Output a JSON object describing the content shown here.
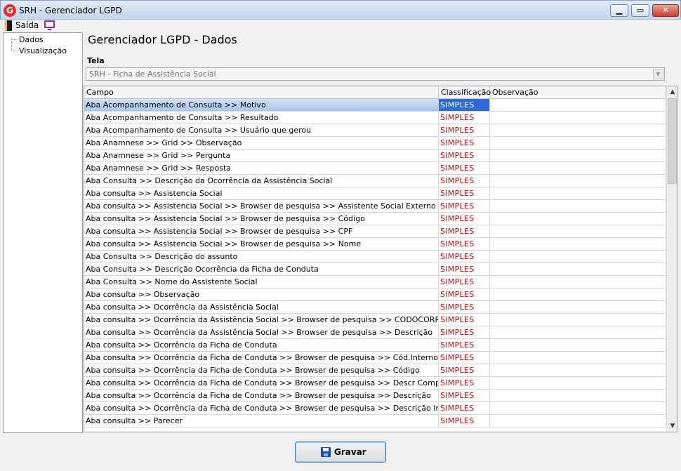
{
  "window": {
    "title": "SRH - Gerenciador LGPD",
    "app_icon_letter": "G",
    "minimize_glyph": "▁",
    "maximize_glyph": "▭",
    "close_glyph": "✕"
  },
  "menu": {
    "exit_label": "Saída"
  },
  "tree": {
    "items": [
      "Dados",
      "Visualização"
    ]
  },
  "page": {
    "title": "Gerenciador LGPD - Dados",
    "tela_label": "Tela",
    "tela_value": "SRH - Ficha de Assistência Social"
  },
  "grid": {
    "columns": [
      "Campo",
      "Classificação",
      "Observação"
    ],
    "rows": [
      {
        "campo": "Aba Acompanhamento de Consulta >> Motivo",
        "classificacao": "SIMPLES",
        "observacao": ""
      },
      {
        "campo": "Aba Acompanhamento de Consulta >> Resultado",
        "classificacao": "SIMPLES",
        "observacao": ""
      },
      {
        "campo": "Aba Acompanhamento de Consulta >> Usuário que gerou",
        "classificacao": "SIMPLES",
        "observacao": ""
      },
      {
        "campo": "Aba Anamnese >> Grid >> Observação",
        "classificacao": "SIMPLES",
        "observacao": ""
      },
      {
        "campo": "Aba Anamnese >> Grid >> Pergunta",
        "classificacao": "SIMPLES",
        "observacao": ""
      },
      {
        "campo": "Aba Anamnese >> Grid >> Resposta",
        "classificacao": "SIMPLES",
        "observacao": ""
      },
      {
        "campo": "Aba Consulta >>  Descrição da Ocorrência da Assistência Social",
        "classificacao": "SIMPLES",
        "observacao": ""
      },
      {
        "campo": "Aba consulta >> Assistencia Social",
        "classificacao": "SIMPLES",
        "observacao": ""
      },
      {
        "campo": "Aba consulta >> Assistencia Social >> Browser de pesquisa >> Assistente Social Externo",
        "classificacao": "SIMPLES",
        "observacao": ""
      },
      {
        "campo": "Aba consulta >> Assistencia Social >> Browser de pesquisa >> Código",
        "classificacao": "SIMPLES",
        "observacao": ""
      },
      {
        "campo": "Aba consulta >> Assistencia Social >> Browser de pesquisa >> CPF",
        "classificacao": "SIMPLES",
        "observacao": ""
      },
      {
        "campo": "Aba consulta >> Assistencia Social >> Browser de pesquisa >> Nome",
        "classificacao": "SIMPLES",
        "observacao": ""
      },
      {
        "campo": "Aba Consulta >> Descrição do assunto",
        "classificacao": "SIMPLES",
        "observacao": ""
      },
      {
        "campo": "Aba Consulta >> Descrição Ocorrência da Ficha de Conduta",
        "classificacao": "SIMPLES",
        "observacao": ""
      },
      {
        "campo": "Aba Consulta >> Nome do Assistente Social",
        "classificacao": "SIMPLES",
        "observacao": ""
      },
      {
        "campo": "Aba consulta >> Observação",
        "classificacao": "SIMPLES",
        "observacao": ""
      },
      {
        "campo": "Aba consulta >> Ocorrência da Assistência Social",
        "classificacao": "SIMPLES",
        "observacao": ""
      },
      {
        "campo": "Aba consulta >> Ocorrência da Assistência Social >> Browser de pesquisa >> CODOCORR",
        "classificacao": "SIMPLES",
        "observacao": ""
      },
      {
        "campo": "Aba consulta >> Ocorrência da Assistência Social >> Browser de pesquisa >> Descrição",
        "classificacao": "SIMPLES",
        "observacao": ""
      },
      {
        "campo": "Aba consulta >> Ocorrência da Ficha de Conduta",
        "classificacao": "SIMPLES",
        "observacao": ""
      },
      {
        "campo": "Aba consulta >> Ocorrência da Ficha de Conduta >> Browser de pesquisa >> Cód.Interno",
        "classificacao": "SIMPLES",
        "observacao": ""
      },
      {
        "campo": "Aba consulta >> Ocorrência da Ficha de Conduta >> Browser de pesquisa >> Código",
        "classificacao": "SIMPLES",
        "observacao": ""
      },
      {
        "campo": "Aba consulta >> Ocorrência da Ficha de Conduta >> Browser de pesquisa >> Descr Completa",
        "classificacao": "SIMPLES",
        "observacao": ""
      },
      {
        "campo": "Aba consulta >> Ocorrência da Ficha de Conduta >> Browser de pesquisa >> Descrição",
        "classificacao": "SIMPLES",
        "observacao": ""
      },
      {
        "campo": "Aba consulta >> Ocorrência da Ficha de Conduta >> Browser de pesquisa >> Descrição Interna",
        "classificacao": "SIMPLES",
        "observacao": ""
      },
      {
        "campo": "Aba consulta >> Parecer",
        "classificacao": "SIMPLES",
        "observacao": ""
      }
    ],
    "selected_row": 0
  },
  "actions": {
    "save_label": "Gravar"
  },
  "icons": {
    "app": "app-logo-icon",
    "exit": "exit-door-icon",
    "monitor": "monitor-icon",
    "save": "floppy-disk-icon",
    "combo_arrow": "chevron-down-icon",
    "scroll_up": "arrow-up-icon",
    "scroll_down": "arrow-down-icon"
  },
  "colors": {
    "classification_text": "#d00000",
    "selection_blue": "#2e6ad6",
    "accent_border": "#3c7fb1"
  }
}
